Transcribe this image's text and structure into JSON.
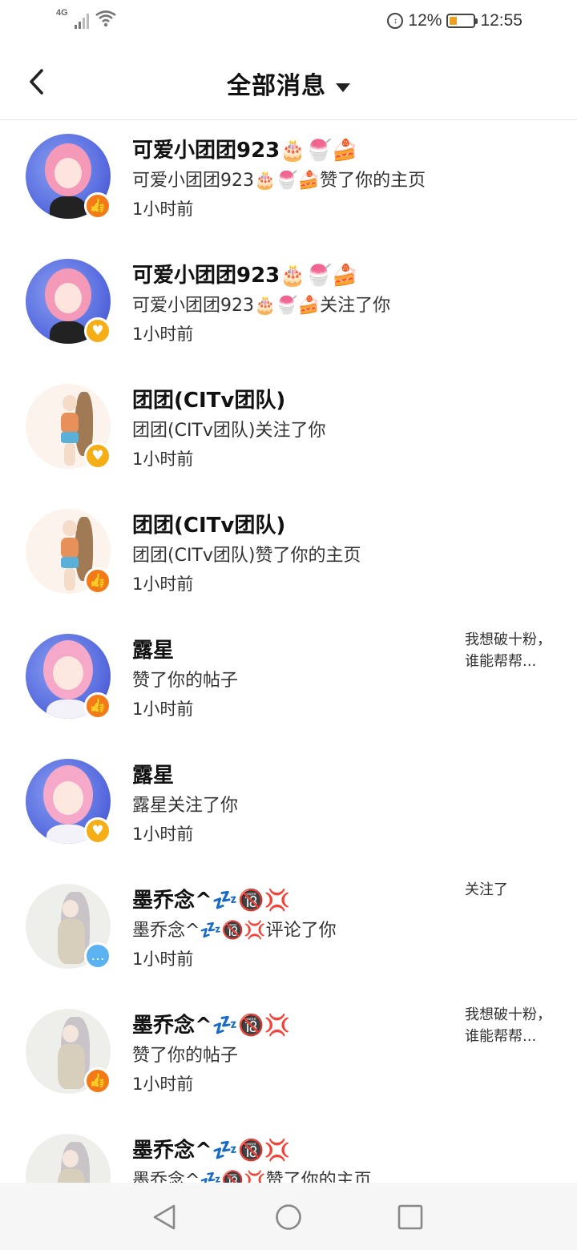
{
  "status_bar": {
    "network": "4G",
    "battery_percent": "12%",
    "time": "12:55",
    "icons": [
      "signal-icon",
      "wifi-icon",
      "data-saver-icon",
      "battery-charging-icon"
    ]
  },
  "header": {
    "title": "全部消息",
    "back_icon": "chevron-left-icon",
    "dropdown_icon": "caret-down-icon"
  },
  "notifications": [
    {
      "name": "可爱小团团923🎂🍧🍰",
      "action": "可爱小团团923🎂🍧🍰赞了你的主页",
      "time": "1小时前",
      "badge": "like",
      "preview": ""
    },
    {
      "name": "可爱小团团923🎂🍧🍰",
      "action": "可爱小团团923🎂🍧🍰关注了你",
      "time": "1小时前",
      "badge": "follow",
      "preview": ""
    },
    {
      "name": "团团(CITv团队)",
      "action": "团团(CITv团队)关注了你",
      "time": "1小时前",
      "badge": "follow",
      "preview": ""
    },
    {
      "name": "团团(CITv团队)",
      "action": "团团(CITv团队)赞了你的主页",
      "time": "1小时前",
      "badge": "like",
      "preview": ""
    },
    {
      "name": "露星",
      "action": "赞了你的帖子",
      "time": "1小时前",
      "badge": "like",
      "preview": "我想破十粉，谁能帮帮..."
    },
    {
      "name": "露星",
      "action": "露星关注了你",
      "time": "1小时前",
      "badge": "follow",
      "preview": ""
    },
    {
      "name": "墨乔念^💤🔞💢",
      "action": "墨乔念^💤🔞💢评论了你",
      "time": "1小时前",
      "badge": "comment",
      "preview": "关注了"
    },
    {
      "name": "墨乔念^💤🔞💢",
      "action": "赞了你的帖子",
      "time": "1小时前",
      "badge": "like",
      "preview": "我想破十粉，谁能帮帮..."
    },
    {
      "name": "墨乔念^💤🔞💢",
      "action": "墨乔念^💤🔞💢赞了你的主页",
      "time": "",
      "badge": "",
      "preview": ""
    }
  ],
  "colors": {
    "like_badge": "#f47a17",
    "follow_badge": "#f6ae16",
    "comment_badge": "#5bb2f0"
  },
  "nav_bar": {
    "back": "triangle-back-icon",
    "home": "circle-home-icon",
    "recents": "square-recents-icon"
  }
}
